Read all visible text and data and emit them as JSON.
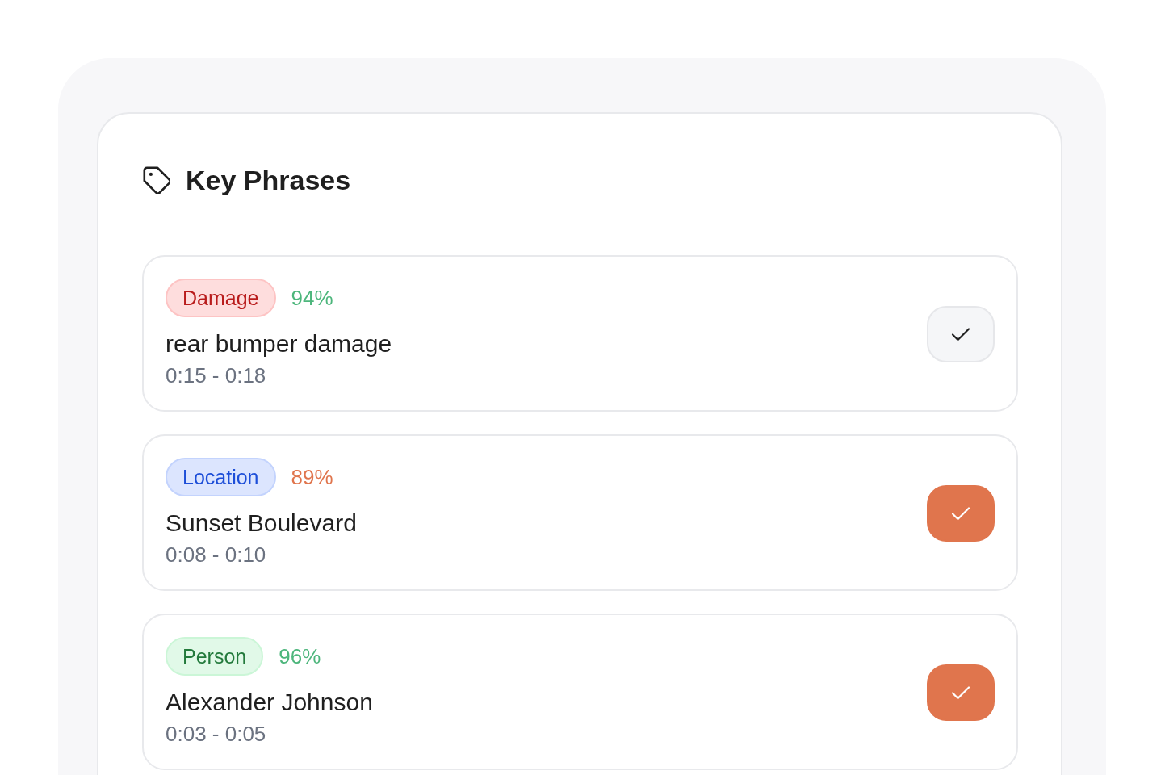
{
  "panel": {
    "title": "Key Phrases"
  },
  "phrases": [
    {
      "category": "Damage",
      "color": "#b91c1c",
      "confidence": "94%",
      "below_threshold": false,
      "text": "rear bumper damage",
      "time": "0:15 - 0:18",
      "checked": false
    },
    {
      "category": "Location",
      "color": "#1d4ed8",
      "confidence": "89%",
      "below_threshold": true,
      "text": "Sunset Boulevard",
      "time": "0:08 - 0:10",
      "checked": true
    },
    {
      "category": "Person",
      "color": "#237a3c",
      "confidence": "96%",
      "below_threshold": false,
      "text": "Alexander Johnson",
      "time": "0:03 - 0:05",
      "checked": true
    }
  ]
}
